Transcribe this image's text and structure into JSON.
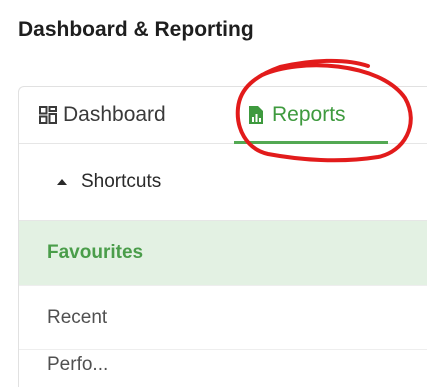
{
  "page": {
    "title": "Dashboard & Reporting"
  },
  "tabs": [
    {
      "label": "Dashboard",
      "icon": "grid-icon"
    },
    {
      "label": "Reports",
      "icon": "chart-file-icon",
      "active": true
    }
  ],
  "shortcuts": {
    "label": "Shortcuts",
    "expanded": true
  },
  "nav_items": [
    {
      "label": "Favourites",
      "active": true
    },
    {
      "label": "Recent"
    },
    {
      "label": "Perfo..."
    }
  ],
  "colors": {
    "accent": "#53a953",
    "active_bg": "#e3f1e3",
    "annotation": "#e21b1b"
  }
}
